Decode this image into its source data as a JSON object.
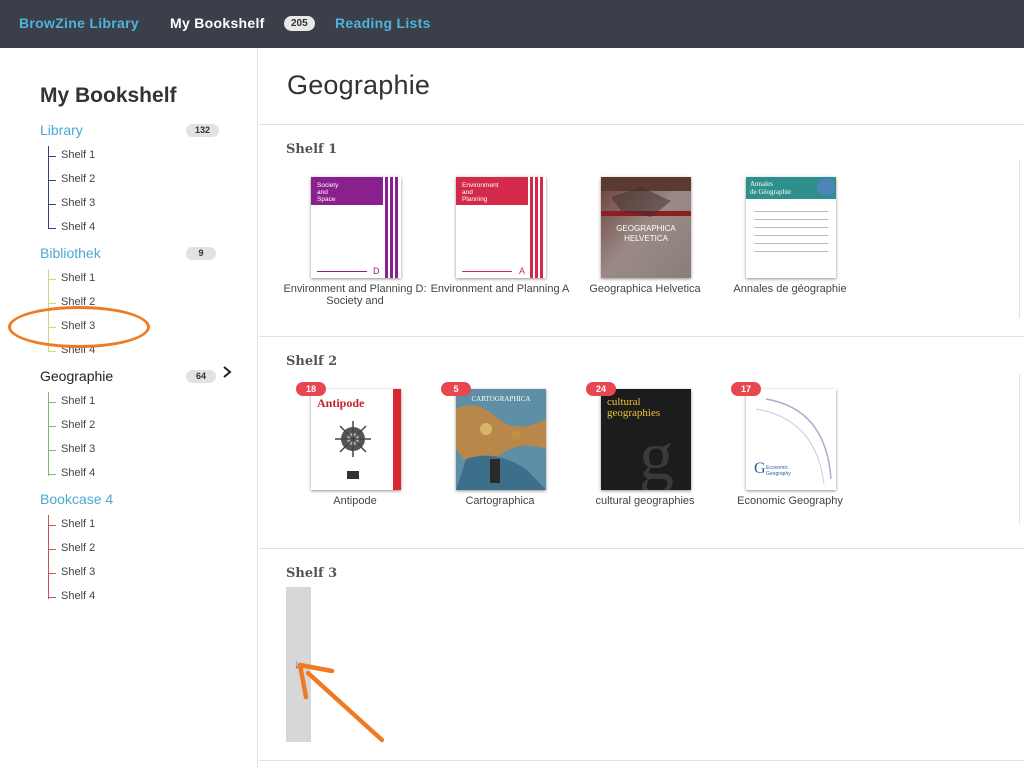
{
  "nav": {
    "browzine_label": "BrowZine Library",
    "bookshelf_label": "My Bookshelf",
    "bookshelf_count": "205",
    "reading_lists_label": "Reading Lists"
  },
  "sidebar": {
    "title": "My Bookshelf",
    "bookcases": [
      {
        "name": "Library",
        "count": "132",
        "color": "#33427a",
        "shelves": [
          "Shelf 1",
          "Shelf 2",
          "Shelf 3",
          "Shelf 4"
        ]
      },
      {
        "name": "Bibliothek",
        "count": "9",
        "color": "#d8d27a",
        "shelves": [
          "Shelf 1",
          "Shelf 2",
          "Shelf 3",
          "Shelf 4"
        ]
      },
      {
        "name": "Geographie",
        "count": "64",
        "color": "#7dbb6a",
        "shelves": [
          "Shelf 1",
          "Shelf 2",
          "Shelf 3",
          "Shelf 4"
        ]
      },
      {
        "name": "Bookcase 4",
        "count": "",
        "color": "#c9505b",
        "shelves": [
          "Shelf 1",
          "Shelf 2",
          "Shelf 3",
          "Shelf 4"
        ]
      }
    ]
  },
  "main": {
    "title": "Geographie",
    "shelves": [
      {
        "label": "Shelf 1",
        "books": [
          {
            "title": "Environment and Planning D: Society and",
            "badge": "",
            "cover_text": "Society and Space"
          },
          {
            "title": "Environment and Planning A",
            "badge": "",
            "cover_text": "Environment and Planning"
          },
          {
            "title": "Geographica Helvetica",
            "badge": "",
            "cover_text": "GEOGRAPHICA HELVETICA"
          },
          {
            "title": "Annales de géographie",
            "badge": "",
            "cover_text": "Annales de Géographie"
          }
        ]
      },
      {
        "label": "Shelf 2",
        "books": [
          {
            "title": "Antipode",
            "badge": "18",
            "cover_text": "Antipode"
          },
          {
            "title": "Cartographica",
            "badge": "5",
            "cover_text": "CARTOGRAPHICA"
          },
          {
            "title": "cultural geographies",
            "badge": "24",
            "cover_text": "cultural geographies"
          },
          {
            "title": "Economic Geography",
            "badge": "17",
            "cover_text": "Economic Geography"
          }
        ]
      },
      {
        "label": "Shelf 3",
        "books": []
      }
    ]
  },
  "colors": {
    "nav_bg": "#3a3f49",
    "link": "#4fb3dc",
    "badge_red": "#e8474f",
    "annotation": "#f07a21"
  }
}
